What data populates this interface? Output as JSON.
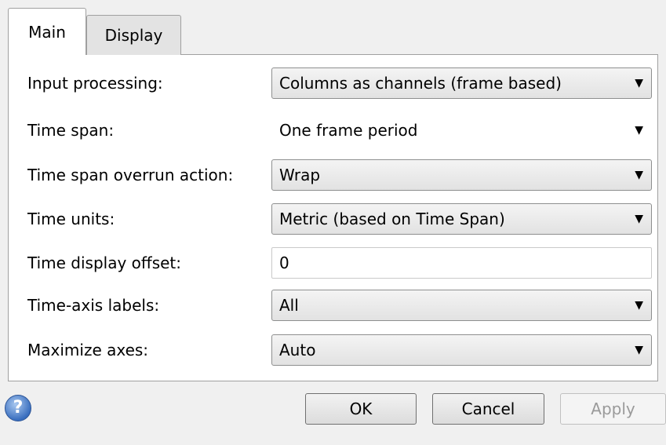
{
  "tabs": [
    {
      "label": "Main",
      "active": true
    },
    {
      "label": "Display",
      "active": false
    }
  ],
  "form": {
    "input_processing": {
      "label": "Input processing:",
      "value": "Columns as channels (frame based)"
    },
    "time_span": {
      "label": "Time span:",
      "value": "One frame period"
    },
    "overrun_action": {
      "label": "Time span overrun action:",
      "value": "Wrap"
    },
    "time_units": {
      "label": "Time units:",
      "value": "Metric (based on Time Span)"
    },
    "display_offset": {
      "label": "Time display offset:",
      "value": "0"
    },
    "axis_labels": {
      "label": "Time-axis labels:",
      "value": "All"
    },
    "maximize_axes": {
      "label": "Maximize axes:",
      "value": "Auto"
    }
  },
  "icons": {
    "dropdown_arrow": "▼",
    "help": "?"
  },
  "buttons": {
    "ok": "OK",
    "cancel": "Cancel",
    "apply": "Apply",
    "apply_enabled": false
  }
}
